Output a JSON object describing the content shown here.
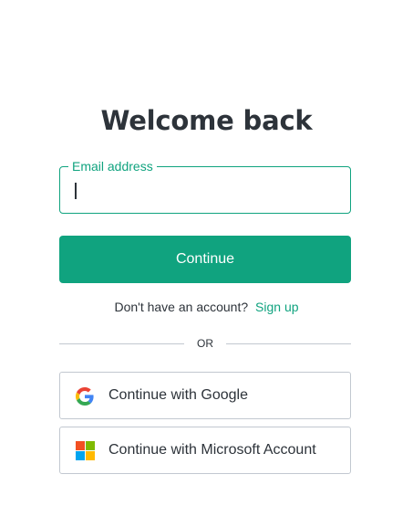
{
  "page": {
    "title": "Welcome back"
  },
  "email": {
    "label": "Email address",
    "value": ""
  },
  "continue_button": {
    "label": "Continue"
  },
  "signup": {
    "prompt": "Don't have an account?",
    "link": "Sign up"
  },
  "divider": {
    "text": "OR"
  },
  "social": {
    "google": {
      "label": "Continue with Google",
      "icon": "google-logo-icon"
    },
    "microsoft": {
      "label": "Continue with Microsoft Account",
      "icon": "microsoft-logo-icon"
    }
  },
  "colors": {
    "accent": "#10a37f",
    "text": "#2d333a",
    "border": "#c2c8d0",
    "ms_red": "#f25022",
    "ms_green": "#7fba00",
    "ms_blue": "#00a4ef",
    "ms_yellow": "#ffb900"
  }
}
